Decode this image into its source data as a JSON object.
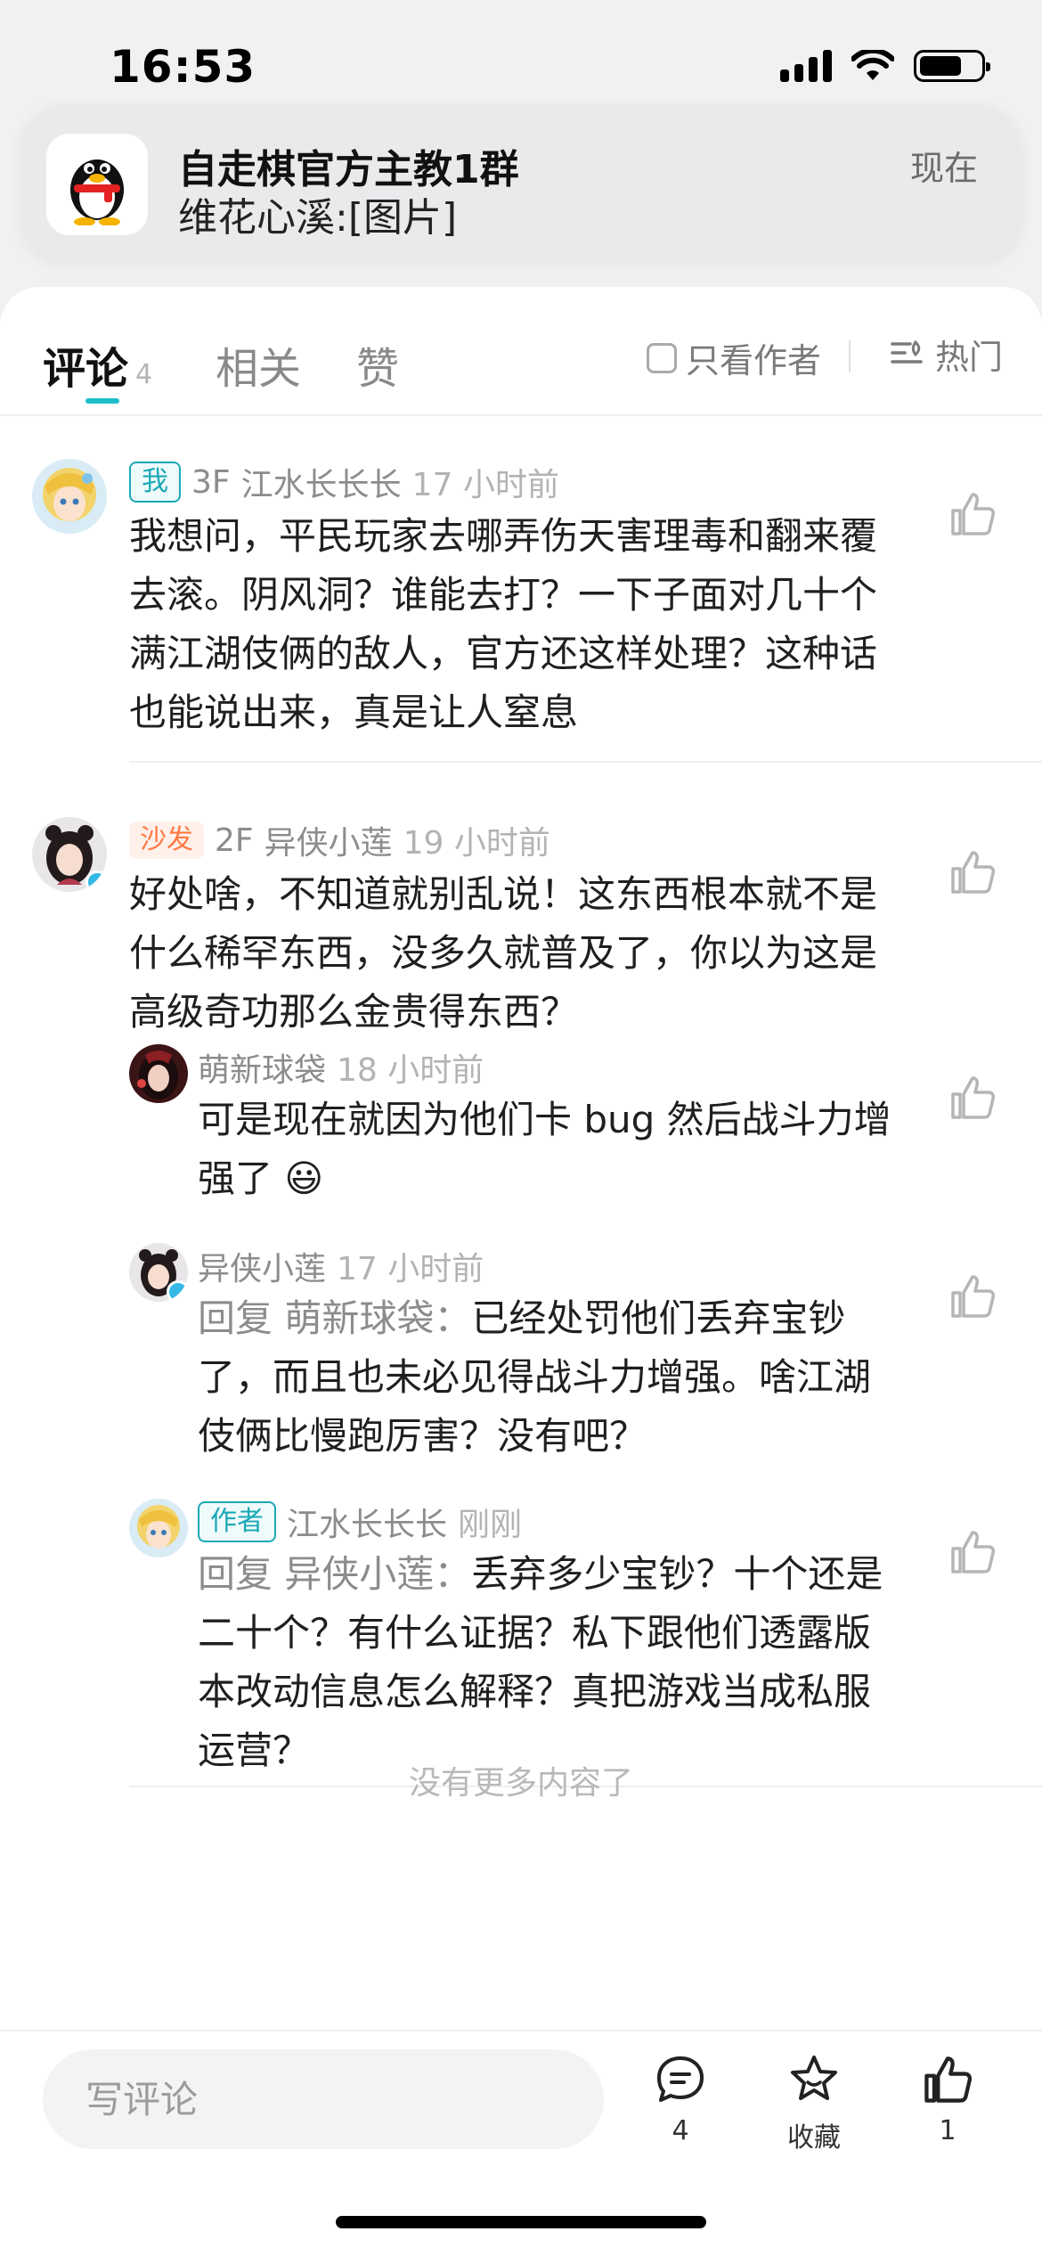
{
  "status_bar": {
    "time": "16:53"
  },
  "notification": {
    "app_icon": "qq-penguin-icon",
    "title": "自走棋官方主教1群",
    "body": "维花心溪:[图片]",
    "time": "现在"
  },
  "tabs": {
    "comments_label": "评论",
    "comments_count": "4",
    "related_label": "相关",
    "likes_label": "赞",
    "only_author_label": "只看作者",
    "hot_label": "热门",
    "accent_color": "#1dbec8"
  },
  "comments": [
    {
      "badge": "我",
      "floor": "3F",
      "user": "江水长长长",
      "ago": "17 小时前",
      "lines": [
        "我想问，平民玩家去哪弄伤天害理毒和翻来覆",
        "去滚。阴风洞？谁能去打？一下子面对几十个",
        "满江湖伎俩的敌人，官方还这样处理？这种话",
        "也能说出来，真是让人窒息"
      ]
    },
    {
      "badge": "沙发",
      "floor": "2F",
      "user": "异侠小莲",
      "ago": "19 小时前",
      "lines": [
        "好处啥，不知道就别乱说！这东西根本就不是",
        "什么稀罕东西，没多久就普及了，你以为这是",
        "高级奇功那么金贵得东西？"
      ],
      "replies": [
        {
          "user": "萌新球袋",
          "ago": "18 小时前",
          "lines": [
            "可是现在就因为他们卡 bug 然后战斗力增",
            "强了"
          ],
          "emoji": "😃"
        },
        {
          "user": "异侠小莲",
          "ago": "17 小时前",
          "reply_prefix": "回复 萌新球袋：",
          "lines": [
            "已经处罚他们丢弃宝钞",
            "了，而且也未必见得战斗力增强。啥江湖",
            "伎俩比慢跑厉害？没有吧？"
          ]
        },
        {
          "badge": "作者",
          "user": "江水长长长",
          "ago": "刚刚",
          "reply_prefix": "回复 异侠小莲：",
          "lines": [
            "丢弃多少宝钞？十个还是",
            "二十个？有什么证据？私下跟他们透露版",
            "本改动信息怎么解释？真把游戏当成私服",
            "运营？"
          ]
        }
      ]
    }
  ],
  "end_text": "没有更多内容了",
  "bottom_bar": {
    "input_placeholder": "写评论",
    "comment_count": "4",
    "favorite_label": "收藏",
    "like_count": "1"
  }
}
